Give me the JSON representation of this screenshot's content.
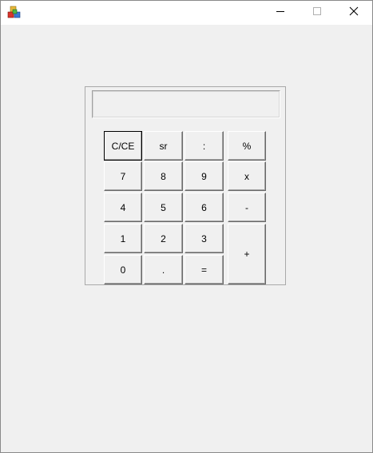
{
  "window": {
    "title": "",
    "app_icon": "cubes-icon",
    "controls": {
      "minimize_icon": "minimize-icon",
      "maximize_icon": "maximize-icon",
      "close_icon": "close-icon"
    }
  },
  "calculator": {
    "display_value": "",
    "keys": {
      "clear": "C/CE",
      "sqrt": "sr",
      "divide": ":",
      "percent": "%",
      "seven": "7",
      "eight": "8",
      "nine": "9",
      "multiply": "x",
      "four": "4",
      "five": "5",
      "six": "6",
      "minus": "-",
      "one": "1",
      "two": "2",
      "three": "3",
      "plus": "+",
      "zero": "0",
      "dot": ".",
      "equals": "="
    }
  }
}
